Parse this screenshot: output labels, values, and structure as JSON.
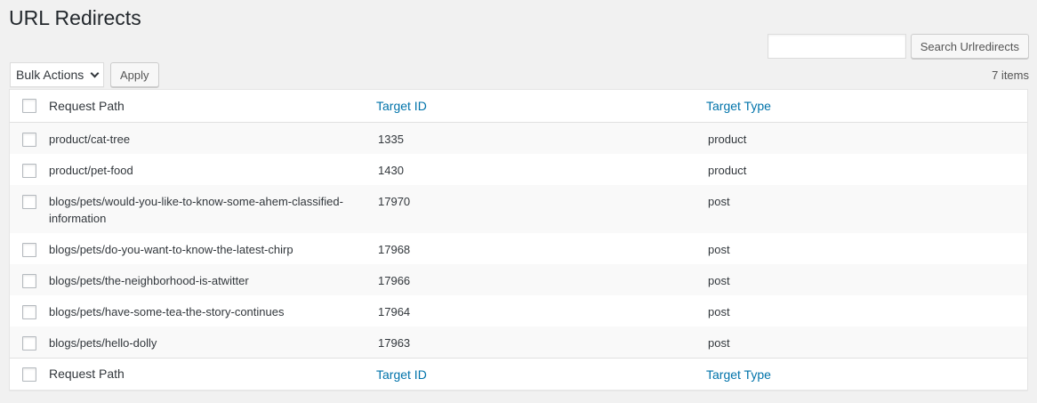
{
  "page": {
    "title": "URL Redirects"
  },
  "search": {
    "value": "",
    "button_label": "Search Urlredirects"
  },
  "bulk": {
    "selected": "Bulk Actions",
    "apply_label": "Apply"
  },
  "items_count": "7 items",
  "table": {
    "columns": {
      "path": "Request Path",
      "target_id": "Target ID",
      "target_type": "Target Type"
    },
    "rows": [
      {
        "path": "product/cat-tree",
        "target_id": "1335",
        "target_type": "product"
      },
      {
        "path": "product/pet-food",
        "target_id": "1430",
        "target_type": "product"
      },
      {
        "path": "blogs/pets/would-you-like-to-know-some-ahem-classified-information",
        "target_id": "17970",
        "target_type": "post"
      },
      {
        "path": "blogs/pets/do-you-want-to-know-the-latest-chirp",
        "target_id": "17968",
        "target_type": "post"
      },
      {
        "path": "blogs/pets/the-neighborhood-is-atwitter",
        "target_id": "17966",
        "target_type": "post"
      },
      {
        "path": "blogs/pets/have-some-tea-the-story-continues",
        "target_id": "17964",
        "target_type": "post"
      },
      {
        "path": "blogs/pets/hello-dolly",
        "target_id": "17963",
        "target_type": "post"
      }
    ]
  },
  "colors": {
    "link": "#0073aa",
    "background": "#f1f1f1"
  },
  "icons": {
    "select": "chevron-down-icon"
  }
}
